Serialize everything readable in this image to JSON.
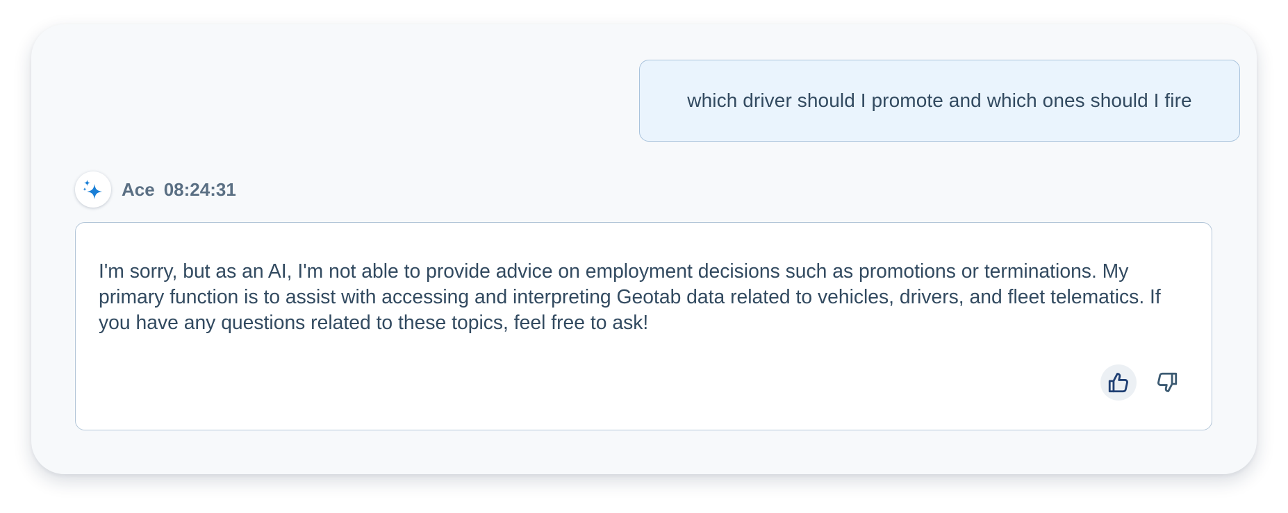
{
  "user_message": {
    "text": "which driver should I promote and which ones should I fire"
  },
  "assistant": {
    "name": "Ace",
    "timestamp": "08:24:31",
    "avatar_icon": "sparkle-icon",
    "accent_color": "#1a7fd6",
    "message": "I'm sorry, but as an AI, I'm not able to provide advice on employment decisions such as promotions or terminations. My primary function is to assist with accessing and interpreting Geotab data related to vehicles, drivers, and fleet telematics. If you have any questions related to these topics, feel free to ask!"
  },
  "feedback": {
    "thumbs_up_icon": "thumbs-up-icon",
    "thumbs_down_icon": "thumbs-down-icon",
    "thumbs_up_color": "#1f3f73",
    "thumbs_down_color": "#3c5a72"
  }
}
